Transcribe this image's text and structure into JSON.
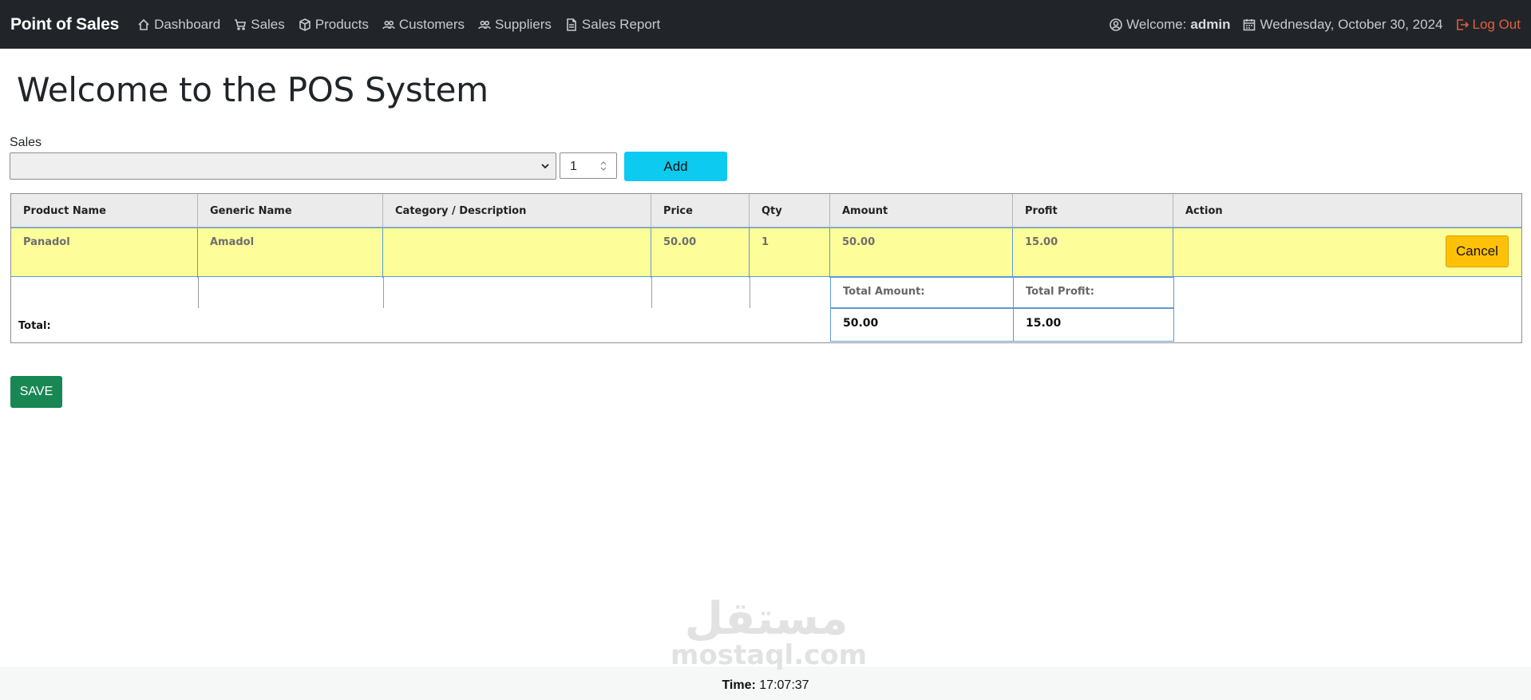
{
  "navbar": {
    "brand": "Point of Sales",
    "items": [
      {
        "label": "Dashboard",
        "icon": "house-icon"
      },
      {
        "label": "Sales",
        "icon": "cart-icon"
      },
      {
        "label": "Products",
        "icon": "box-icon"
      },
      {
        "label": "Customers",
        "icon": "people-icon"
      },
      {
        "label": "Suppliers",
        "icon": "people-icon"
      },
      {
        "label": "Sales Report",
        "icon": "document-icon"
      }
    ],
    "welcome_label": "Welcome:",
    "user": "admin",
    "date": "Wednesday, October 30, 2024",
    "logout": "Log Out",
    "logout_color": "#e0603e"
  },
  "page_title": "Welcome to the POS System",
  "form": {
    "sales_label": "Sales",
    "selected_product": "",
    "qty_value": "1",
    "add_label": "Add",
    "add_color": "#0dcaf0"
  },
  "table": {
    "headers": [
      "Product Name",
      "Generic Name",
      "Category / Description",
      "Price",
      "Qty",
      "Amount",
      "Profit",
      "Action"
    ],
    "rows": [
      {
        "product": "Panadol",
        "generic": "Amadol",
        "category": "",
        "price": "50.00",
        "qty": "1",
        "amount": "50.00",
        "profit": "15.00",
        "action": "Cancel"
      }
    ],
    "row_highlight_color": "#fdfd9a",
    "total_label": "Total:",
    "total_amount_label": "Total Amount:",
    "total_amount": "50.00",
    "total_profit_label": "Total Profit:",
    "total_profit": "15.00"
  },
  "save_label": "SAVE",
  "save_color": "#198754",
  "watermark": {
    "arabic": "مستقل",
    "latin": "mostaql.com"
  },
  "footer": {
    "time_label": "Time:",
    "time": "17:07:37"
  }
}
